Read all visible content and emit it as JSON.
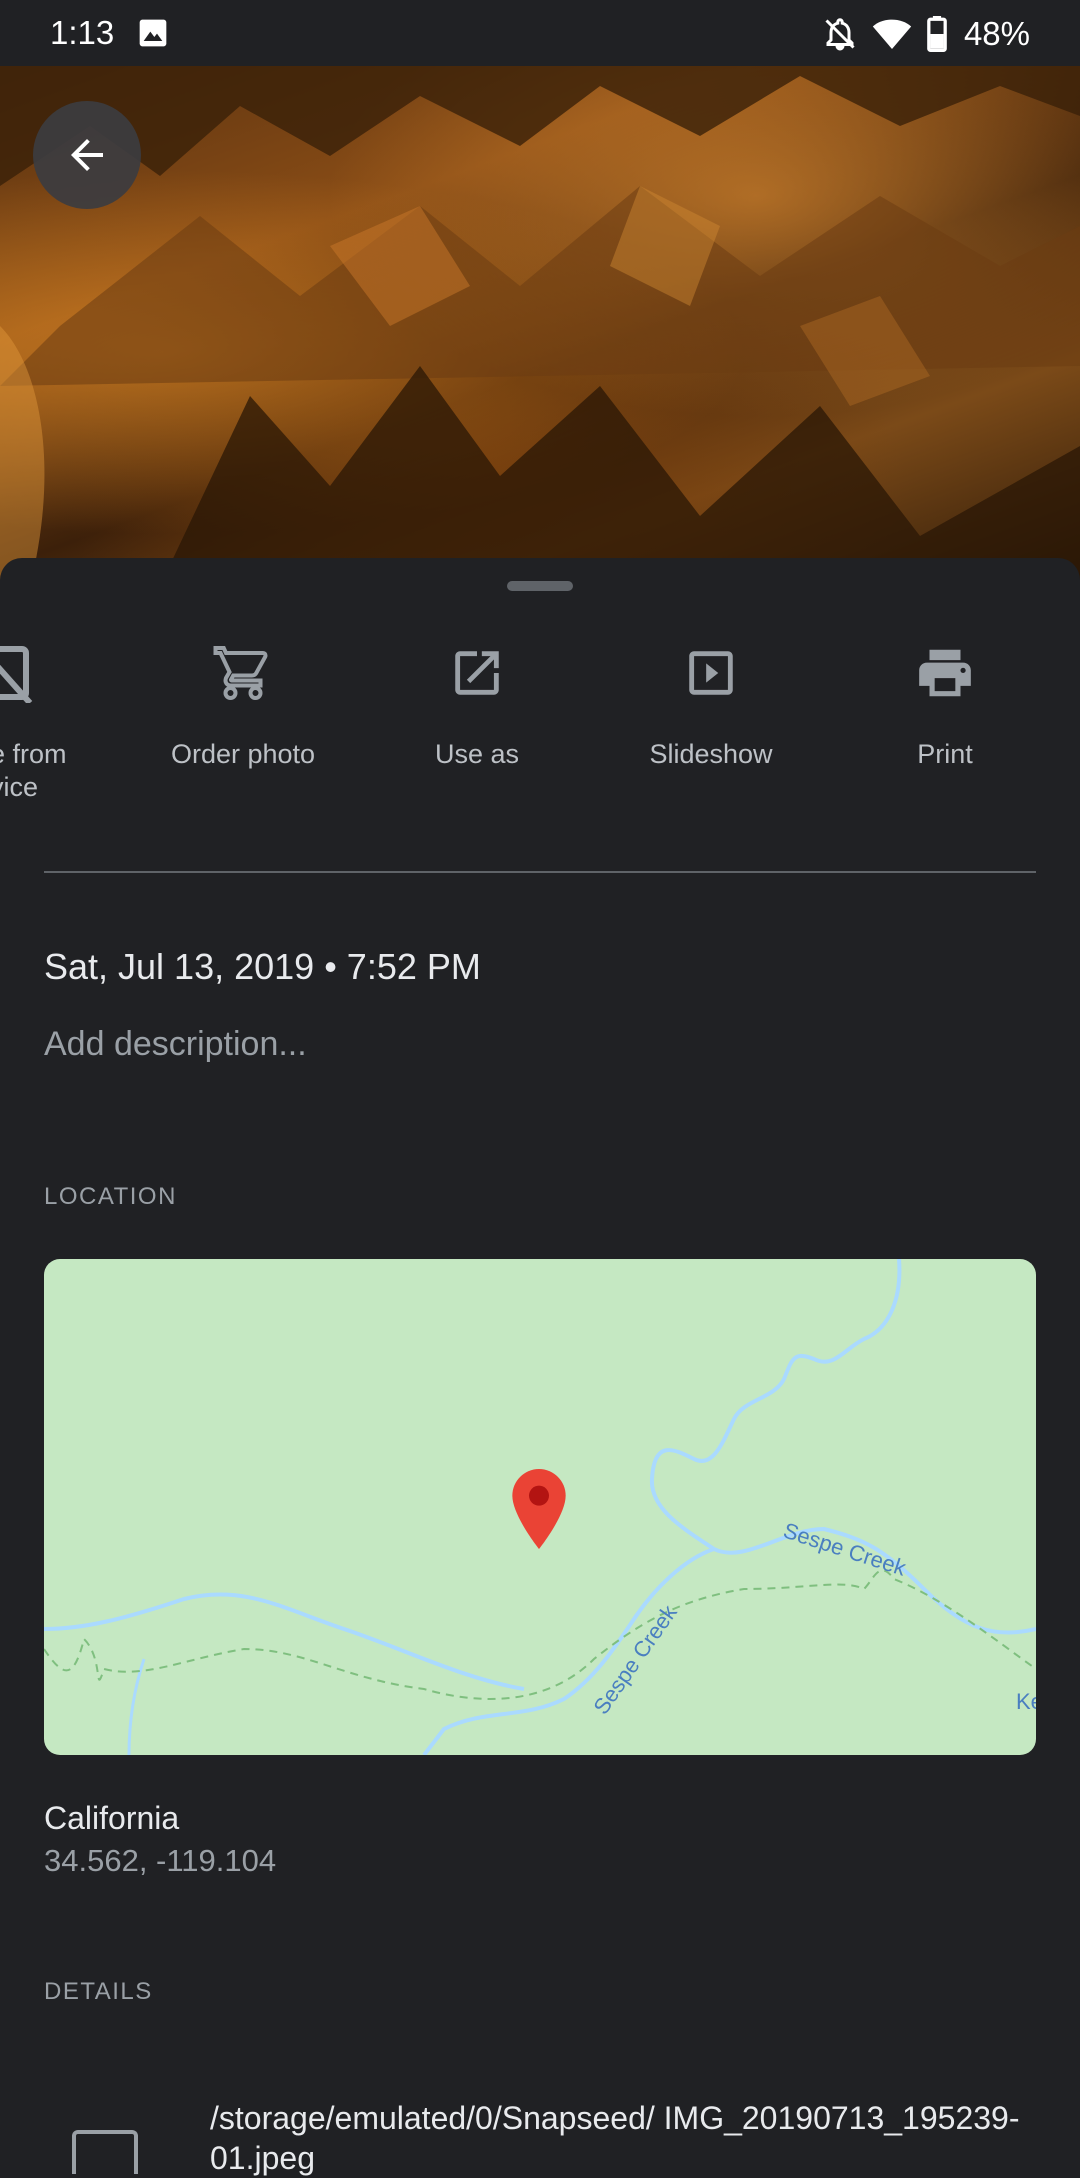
{
  "status_bar": {
    "time": "1:13",
    "battery": "48%",
    "icons": [
      "gallery-icon",
      "notifications-off-icon",
      "wifi-icon",
      "battery-icon"
    ]
  },
  "back_button": {
    "icon": "arrow-back-icon"
  },
  "actions": [
    {
      "label": "e from\nvice",
      "icon": "device-off-icon"
    },
    {
      "label": "Order photo",
      "icon": "cart-icon"
    },
    {
      "label": "Use as",
      "icon": "open-in-new-icon"
    },
    {
      "label": "Slideshow",
      "icon": "slideshow-icon"
    },
    {
      "label": "Print",
      "icon": "print-icon"
    }
  ],
  "info": {
    "datetime": "Sat, Jul 13, 2019  •  7:52 PM",
    "description_placeholder": "Add description..."
  },
  "location": {
    "header": "LOCATION",
    "map_labels": [
      "Sespe Creek",
      "Sespe Creek",
      "Ke"
    ],
    "place": "California",
    "coords": "34.562, -119.104"
  },
  "details": {
    "header": "DETAILS",
    "path": "/storage/emulated/0/Snapseed/ IMG_20190713_195239-01.jpeg"
  },
  "colors": {
    "background": "#202124",
    "map_green": "#c5e8c2",
    "pin_red": "#ea4335",
    "water_blue": "#aadaff"
  }
}
